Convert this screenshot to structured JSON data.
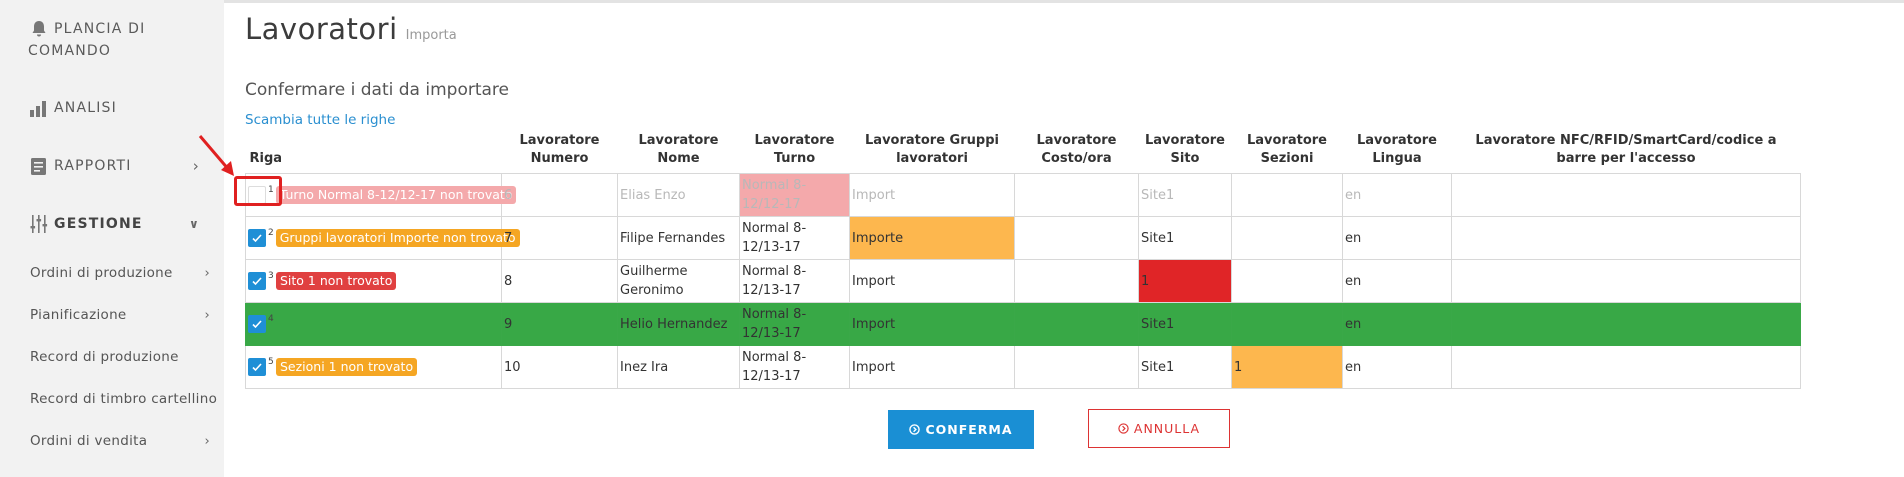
{
  "sidebar": {
    "items": [
      {
        "label_line1": "PLANCIA DI",
        "label_line2": "COMANDO",
        "icon": "bell-icon"
      },
      {
        "label": "ANALISI",
        "icon": "bar-chart-icon"
      },
      {
        "label": "RAPPORTI",
        "icon": "report-icon"
      },
      {
        "label": "GESTIONE",
        "icon": "sliders-icon"
      }
    ],
    "sub_items": [
      {
        "label": "Ordini di produzione"
      },
      {
        "label": "Pianificazione"
      },
      {
        "label": "Record di produzione"
      },
      {
        "label": "Record di timbro cartellino"
      },
      {
        "label": "Ordini di vendita"
      }
    ]
  },
  "header": {
    "title": "Lavoratori",
    "subtitle_small": "Importa"
  },
  "main": {
    "confirm_heading": "Confermare i dati da importare",
    "swap_link": "Scambia tutte le righe"
  },
  "table": {
    "columns": [
      "Riga",
      "Lavoratore Numero",
      "Lavoratore Nome",
      "Lavoratore Turno",
      "Lavoratore Gruppi lavoratori",
      "Lavoratore Costo/ora",
      "Lavoratore Sito",
      "Lavoratore Sezioni",
      "Lavoratore Lingua",
      "Lavoratore NFC/RFID/SmartCard/codice a barre per l'accesso"
    ],
    "rows": [
      {
        "checked": false,
        "index": "1",
        "message": "Turno Normal 8-12/12-17 non trovato",
        "numero": "6",
        "nome": "Elias Enzo",
        "turno": "Normal 8-12/12-17",
        "gruppi": "Import",
        "costo": "",
        "sito": "Site1",
        "sezioni": "",
        "lingua": "en",
        "nfc": ""
      },
      {
        "checked": true,
        "index": "2",
        "message": "Gruppi lavoratori Importe non trovato",
        "numero": "7",
        "nome": "Filipe Fernandes",
        "turno": "Normal 8-12/13-17",
        "gruppi": "Importe",
        "costo": "",
        "sito": "Site1",
        "sezioni": "",
        "lingua": "en",
        "nfc": ""
      },
      {
        "checked": true,
        "index": "3",
        "message": "Sito 1 non trovato",
        "numero": "8",
        "nome": "Guilherme Geronimo",
        "turno": "Normal 8-12/13-17",
        "gruppi": "Import",
        "costo": "",
        "sito": "1",
        "sezioni": "",
        "lingua": "en",
        "nfc": ""
      },
      {
        "checked": true,
        "index": "4",
        "message": "",
        "numero": "9",
        "nome": "Helio Hernandez",
        "turno": "Normal 8-12/13-17",
        "gruppi": "Import",
        "costo": "",
        "sito": "Site1",
        "sezioni": "",
        "lingua": "en",
        "nfc": ""
      },
      {
        "checked": true,
        "index": "5",
        "message": "Sezioni 1 non trovato",
        "numero": "10",
        "nome": "Inez Ira",
        "turno": "Normal 8-12/13-17",
        "gruppi": "Import",
        "costo": "",
        "sito": "Site1",
        "sezioni": "1",
        "lingua": "en",
        "nfc": ""
      }
    ]
  },
  "buttons": {
    "confirm": "CONFERMA",
    "cancel": "ANNULLA"
  },
  "colors": {
    "accent": "#1a8fd4",
    "error_pink": "#f4a9ab",
    "warning_orange": "#fdb74e",
    "error_red": "#e02527",
    "success_green": "#38a846"
  }
}
